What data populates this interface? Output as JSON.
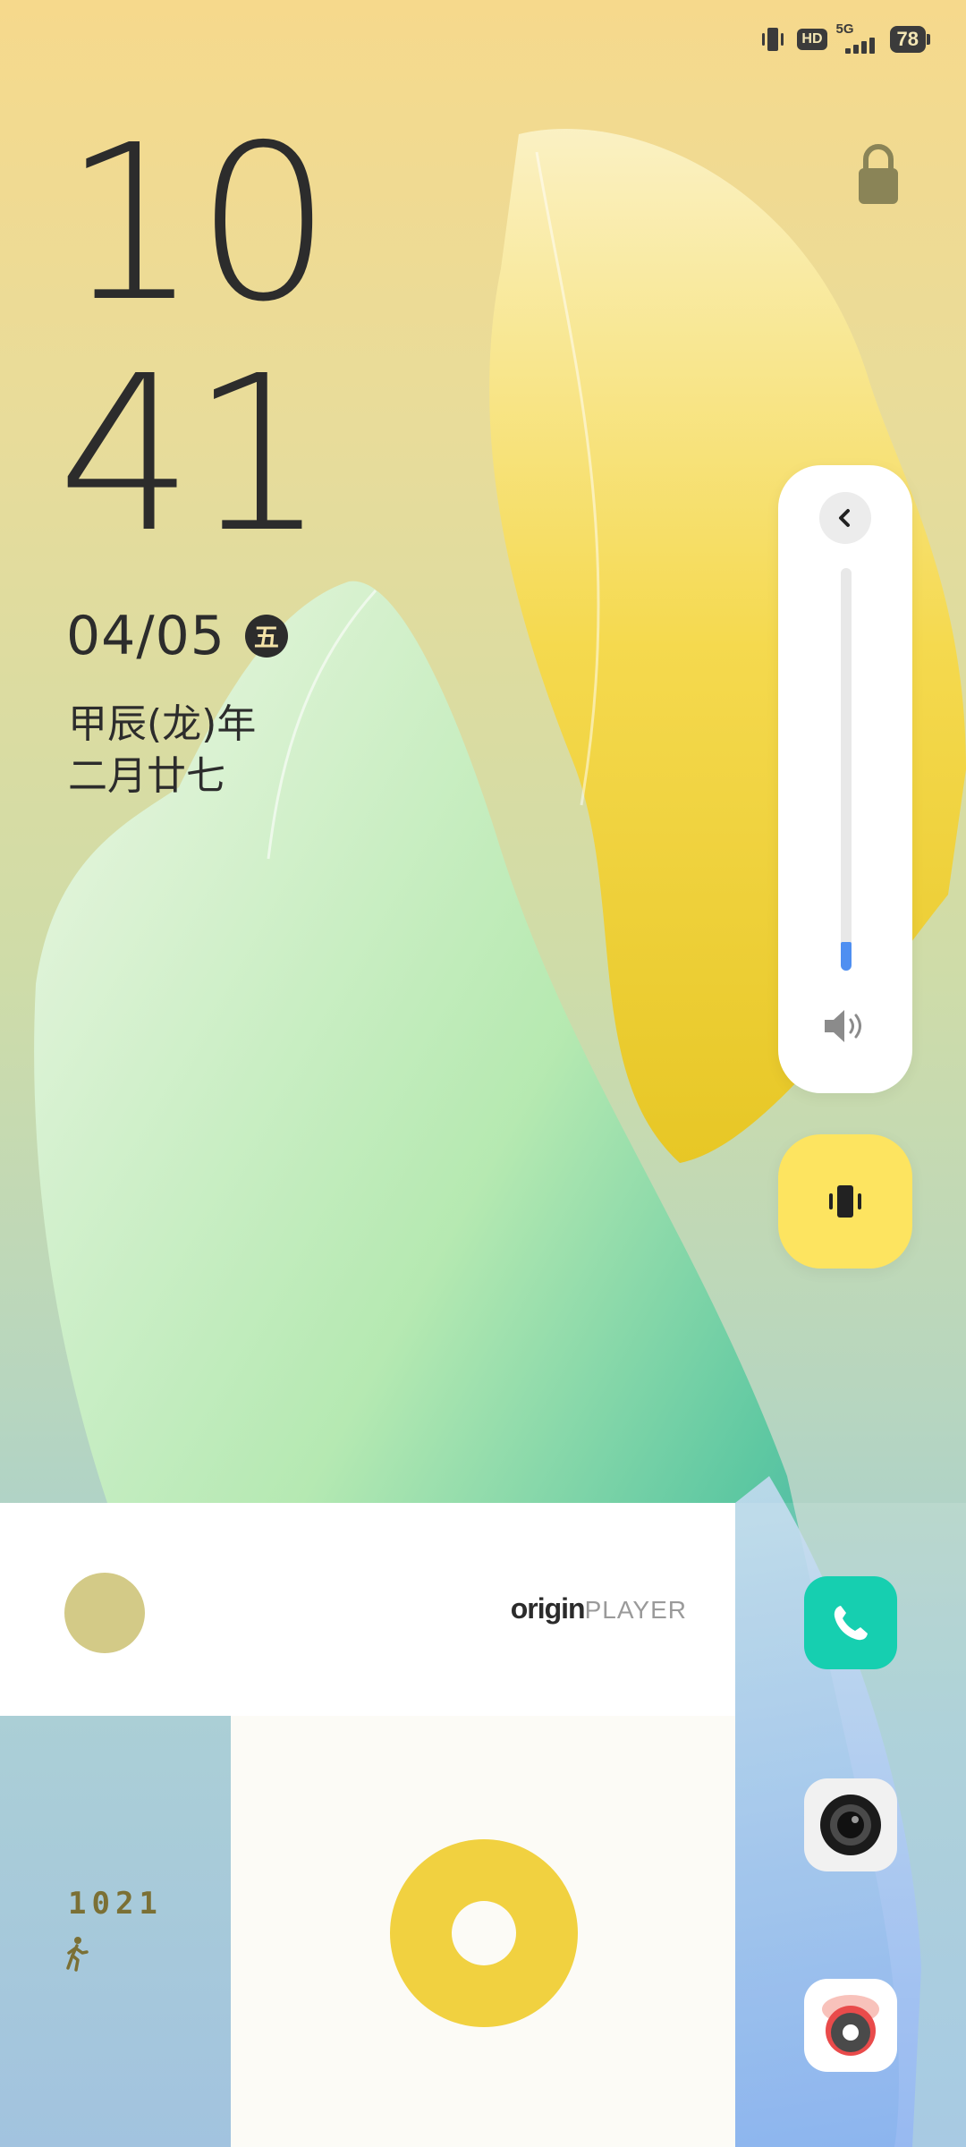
{
  "status_bar": {
    "hd_label": "HD",
    "network_label": "5G",
    "battery_level": "78",
    "icons": [
      "vibrate-icon",
      "hd-icon",
      "signal-5g-icon",
      "battery-icon"
    ]
  },
  "lockscreen": {
    "clock_hour": "10",
    "clock_minute": "41",
    "date": "04/05",
    "weekday": "五",
    "lunar_year": "甲辰(龙)年",
    "lunar_day": "二月廿七",
    "lock_icon": "lock-icon"
  },
  "volume_panel": {
    "back_icon": "chevron-left-icon",
    "level_fraction": 0.07,
    "speaker_icon": "speaker-icon",
    "accent_color": "#4f8ff1"
  },
  "vibrate_button": {
    "icon": "vibrate-icon",
    "color": "#fde460"
  },
  "music_widget": {
    "brand_part1": "origin",
    "brand_part2": "PLAYER"
  },
  "steps_widget": {
    "steps": "1021",
    "icon": "walk-icon"
  },
  "dock": {
    "apps": [
      "phone",
      "camera",
      "recorder"
    ]
  }
}
